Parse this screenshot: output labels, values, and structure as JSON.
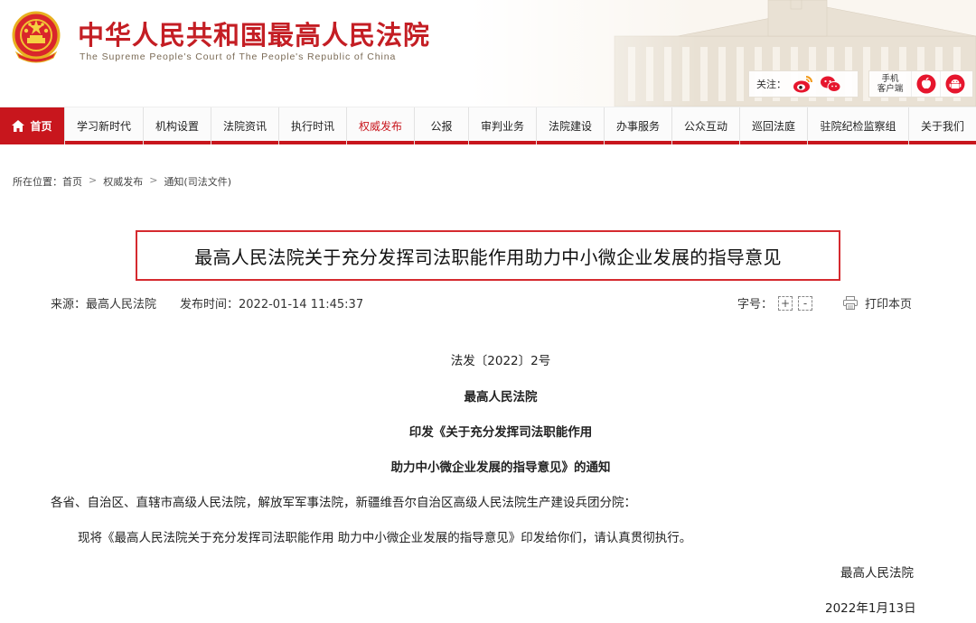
{
  "header": {
    "site_title": "中华人民共和国最高人民法院",
    "site_subtitle": "The Supreme People's Court of The People's Republic of China",
    "follow_label": "关注：",
    "mobile_label_line1": "手机",
    "mobile_label_line2": "客户端",
    "icons": [
      "weibo-icon",
      "wechat-icon",
      "apple-icon",
      "android-icon"
    ],
    "brand_color": "#c8161d"
  },
  "nav": {
    "items": [
      "首页",
      "学习新时代",
      "机构设置",
      "法院资讯",
      "执行时讯",
      "权威发布",
      "公报",
      "审判业务",
      "法院建设",
      "办事服务",
      "公众互动",
      "巡回法庭",
      "驻院纪检监察组",
      "关于我们"
    ],
    "active": "权威发布"
  },
  "breadcrumb": {
    "prefix": "所在位置：",
    "items": [
      "首页",
      "权威发布",
      "通知(司法文件)"
    ]
  },
  "article": {
    "title": "最高人民法院关于充分发挥司法职能作用助力中小微企业发展的指导意见",
    "source": "来源：最高人民法院",
    "published": "发布时间：2022-01-14 11:45:37",
    "font_size_label": "字号：",
    "font_plus": "+",
    "font_minus": "-",
    "print_label": "打印本页",
    "doc_number": "法发〔2022〕2号",
    "issuer": "最高人民法院",
    "notice_line1": "印发《关于充分发挥司法职能作用",
    "notice_line2": "助力中小微企业发展的指导意见》的通知",
    "recipients": "各省、自治区、直辖市高级人民法院，解放军军事法院，新疆维吾尔自治区高级人民法院生产建设兵团分院：",
    "body": "现将《最高人民法院关于充分发挥司法职能作用 助力中小微企业发展的指导意见》印发给你们，请认真贯彻执行。",
    "signature": "最高人民法院",
    "date": "2022年1月13日"
  }
}
